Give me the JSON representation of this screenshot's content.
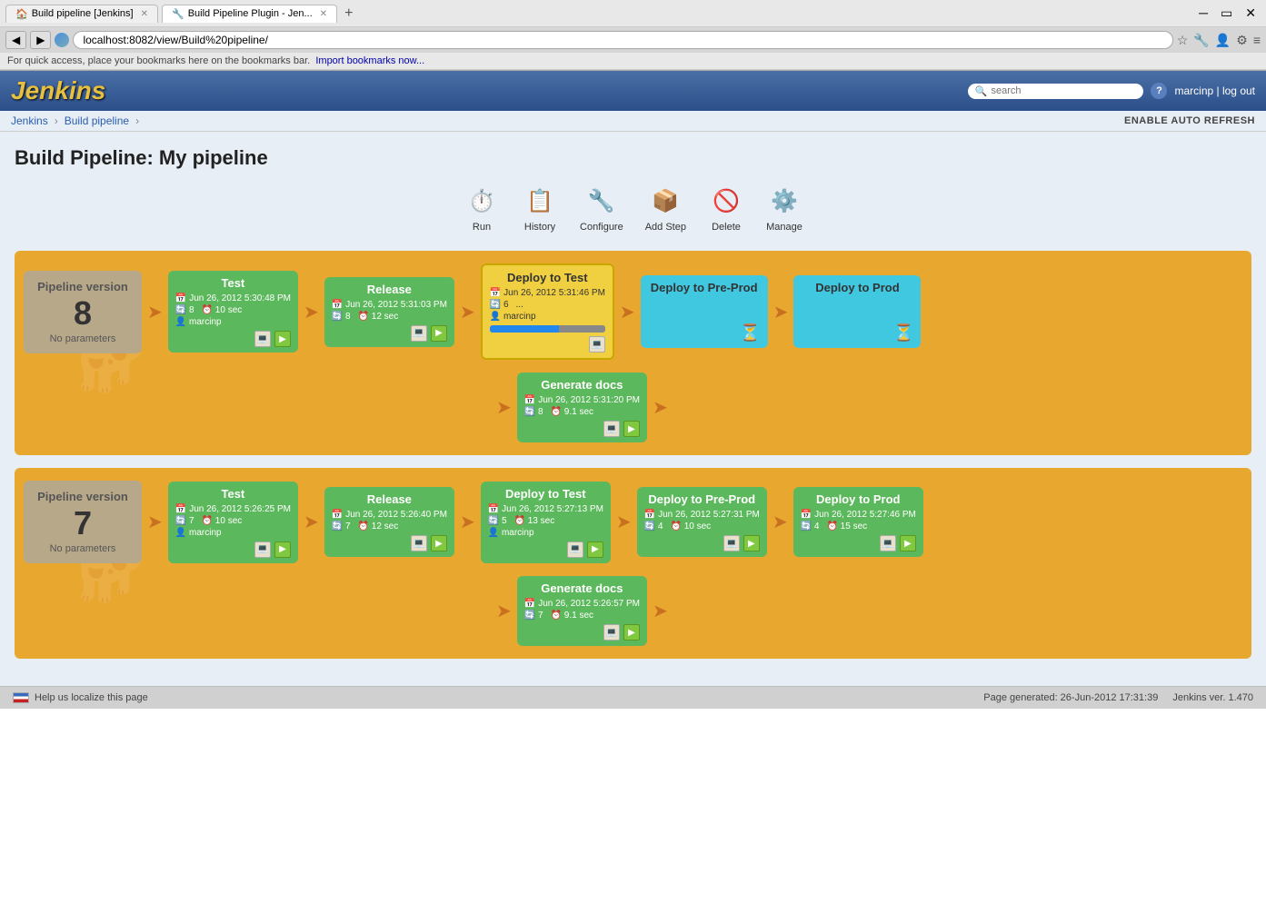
{
  "browser": {
    "tabs": [
      {
        "label": "Build pipeline [Jenkins]",
        "active": false,
        "icon": "🏠"
      },
      {
        "label": "Build Pipeline Plugin - Jen...",
        "active": true,
        "icon": "🔧"
      }
    ],
    "address": "localhost:8082/view/Build%20pipeline/",
    "bookmarks_text": "For quick access, place your bookmarks here on the bookmarks bar.",
    "bookmarks_link": "Import bookmarks now..."
  },
  "header": {
    "logo": "Jenkins",
    "search_placeholder": "search",
    "help_label": "?",
    "user": "marcinp",
    "logout": "log out",
    "separator": "|"
  },
  "breadcrumb": {
    "items": [
      "Jenkins",
      "Build pipeline"
    ],
    "auto_refresh": "ENABLE AUTO REFRESH"
  },
  "page_title": "Build Pipeline: My pipeline",
  "toolbar": {
    "items": [
      {
        "id": "run",
        "label": "Run",
        "icon": "⏱"
      },
      {
        "id": "history",
        "label": "History",
        "icon": "📋"
      },
      {
        "id": "configure",
        "label": "Configure",
        "icon": "🔧"
      },
      {
        "id": "add-step",
        "label": "Add Step",
        "icon": "📦"
      },
      {
        "id": "delete",
        "label": "Delete",
        "icon": "🚫"
      },
      {
        "id": "manage",
        "label": "Manage",
        "icon": "⚙"
      }
    ]
  },
  "pipelines": [
    {
      "version_label": "Pipeline version",
      "version_num": "8",
      "no_params": "No parameters",
      "cards": [
        {
          "id": "test-8",
          "type": "green",
          "title": "Test",
          "date": "Jun 26, 2012 5:30:48 PM",
          "build_num": "8",
          "duration": "10 sec",
          "user": "marcinp"
        },
        {
          "id": "release-8",
          "type": "green",
          "title": "Release",
          "date": "Jun 26, 2012 5:31:03 PM",
          "build_num": "8",
          "duration": "12 sec",
          "user": ""
        },
        {
          "id": "deploy-test-8",
          "type": "yellow",
          "title": "Deploy to Test",
          "date": "Jun 26, 2012 5:31:46 PM",
          "build_num": "6",
          "duration": "...",
          "user": "marcinp",
          "progress": 60
        },
        {
          "id": "generate-docs-8",
          "type": "green",
          "title": "Generate docs",
          "date": "Jun 26, 2012 5:31:20 PM",
          "build_num": "8",
          "duration": "9.1 sec",
          "user": "",
          "sub": true
        },
        {
          "id": "deploy-preprod-8",
          "type": "cyan",
          "title": "Deploy to Pre-Prod",
          "date": "",
          "build_num": "",
          "duration": "",
          "user": "",
          "waiting": true
        },
        {
          "id": "deploy-prod-8",
          "type": "cyan",
          "title": "Deploy to Prod",
          "date": "",
          "build_num": "",
          "duration": "",
          "user": "",
          "waiting": true
        }
      ]
    },
    {
      "version_label": "Pipeline version",
      "version_num": "7",
      "no_params": "No parameters",
      "cards": [
        {
          "id": "test-7",
          "type": "green",
          "title": "Test",
          "date": "Jun 26, 2012 5:26:25 PM",
          "build_num": "7",
          "duration": "10 sec",
          "user": "marcinp"
        },
        {
          "id": "release-7",
          "type": "green",
          "title": "Release",
          "date": "Jun 26, 2012 5:26:40 PM",
          "build_num": "7",
          "duration": "12 sec",
          "user": ""
        },
        {
          "id": "deploy-test-7",
          "type": "green",
          "title": "Deploy to Test",
          "date": "Jun 26, 2012 5:27:13 PM",
          "build_num": "5",
          "duration": "13 sec",
          "user": "marcinp"
        },
        {
          "id": "generate-docs-7",
          "type": "green",
          "title": "Generate docs",
          "date": "Jun 26, 2012 5:26:57 PM",
          "build_num": "7",
          "duration": "9.1 sec",
          "user": "",
          "sub": true
        },
        {
          "id": "deploy-preprod-7",
          "type": "green",
          "title": "Deploy to Pre-Prod",
          "date": "Jun 26, 2012 5:27:31 PM",
          "build_num": "4",
          "duration": "10 sec",
          "user": ""
        },
        {
          "id": "deploy-prod-7",
          "type": "green",
          "title": "Deploy to Prod",
          "date": "Jun 26, 2012 5:27:46 PM",
          "build_num": "4",
          "duration": "15 sec",
          "user": ""
        }
      ]
    }
  ],
  "footer": {
    "localize_text": "Help us localize this page",
    "generated": "Page generated: 26-Jun-2012 17:31:39",
    "version": "Jenkins ver. 1.470"
  }
}
